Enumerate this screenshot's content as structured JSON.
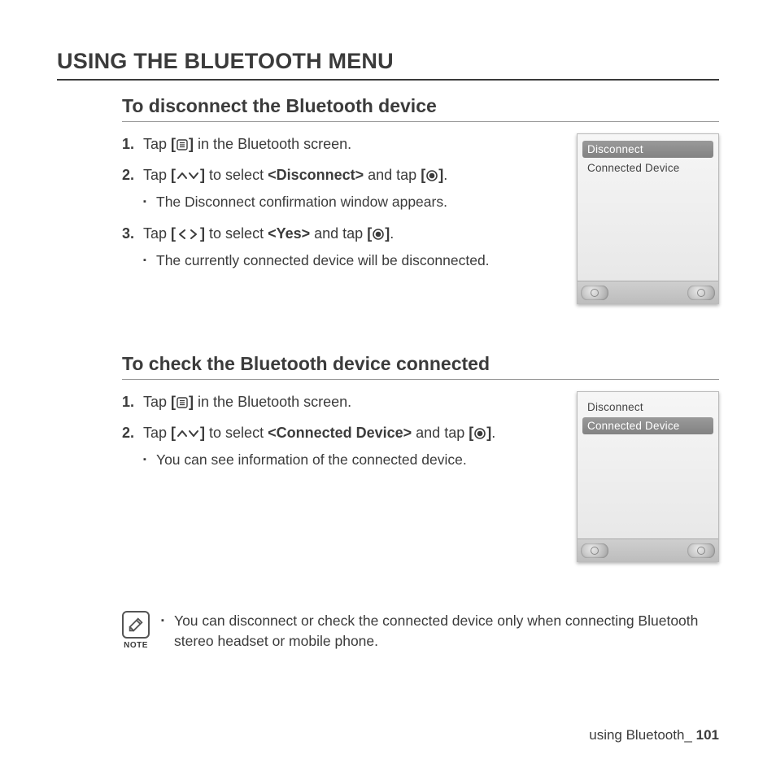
{
  "page_title": "USING THE BLUETOOTH MENU",
  "sections": [
    {
      "heading": "To disconnect the Bluetooth device",
      "steps": [
        {
          "pre": "Tap ",
          "btn_icon": "menu",
          "post": " in the Bluetooth screen.",
          "sub": []
        },
        {
          "pre": "Tap ",
          "btn_icon": "updown",
          "mid": " to select ",
          "bold_target": "<Disconnect>",
          "mid2": " and tap ",
          "btn_icon2": "record",
          "post": ".",
          "sub": [
            "The Disconnect confirmation window appears."
          ]
        },
        {
          "pre": "Tap ",
          "btn_icon": "leftright",
          "mid": " to select ",
          "bold_target": "<Yes>",
          "mid2": " and tap ",
          "btn_icon2": "record",
          "post": ".",
          "sub": [
            "The currently connected device will be disconnected."
          ]
        }
      ],
      "device": {
        "rows": [
          {
            "label": "Disconnect",
            "selected": true
          },
          {
            "label": "Connected Device",
            "selected": false
          }
        ]
      }
    },
    {
      "heading": "To check the Bluetooth device connected",
      "steps": [
        {
          "pre": "Tap ",
          "btn_icon": "menu",
          "post": " in the Bluetooth screen.",
          "sub": []
        },
        {
          "pre": "Tap ",
          "btn_icon": "updown",
          "mid": " to select ",
          "bold_target": "<Connected Device>",
          "mid2": " and tap ",
          "btn_icon2": "record",
          "post": ".",
          "sub": [
            "You can see information of the connected device."
          ]
        }
      ],
      "device": {
        "rows": [
          {
            "label": "Disconnect",
            "selected": false
          },
          {
            "label": "Connected  Device",
            "selected": true
          }
        ]
      }
    }
  ],
  "note": {
    "label": "NOTE",
    "items": [
      "You can disconnect or check the connected device only when connecting Bluetooth stereo headset or mobile phone."
    ]
  },
  "footer": {
    "text": "using Bluetooth_",
    "page": "101"
  },
  "icons": {
    "menu": "menu-icon",
    "updown": "up-down-icon",
    "leftright": "left-right-icon",
    "record": "record-icon"
  }
}
